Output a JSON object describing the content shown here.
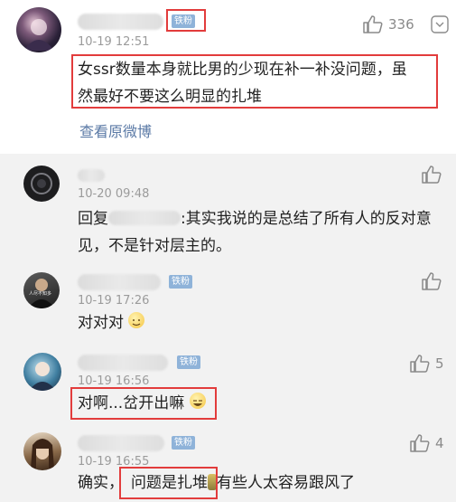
{
  "main_comment": {
    "badge": "铁粉",
    "time": "10-19 12:51",
    "text_line1": "女ssr数量本身就比男的少现在补一补没问题，虽",
    "text_line2": "然最好不要这么明显的扎堆",
    "like_count": "336",
    "view_original": "查看原微博"
  },
  "replies": [
    {
      "time": "10-20 09:48",
      "text_prefix": "回复",
      "text_line1_rest": ":其实我说的是总结了所有人的反对意",
      "text_line2": "见，不是针对层主的。"
    },
    {
      "badge": "铁粉",
      "time": "10-19 17:26",
      "text": "对对对",
      "avatar_text": "人尽不知多"
    },
    {
      "badge": "铁粉",
      "time": "10-19 16:56",
      "text": "对啊...岔开出嘛",
      "like_count": "5"
    },
    {
      "badge": "铁粉",
      "time": "10-19 16:55",
      "text_prefix": "确实，",
      "text_highlight": "问题是扎堆",
      "text_suffix": "有些人太容易跟风了",
      "like_count": "4"
    }
  ],
  "colors": {
    "highlight_box": "#e23c3c",
    "badge": "#8fb3d9",
    "link": "#5b7aa6",
    "reply_bg": "#f2f2f2"
  }
}
